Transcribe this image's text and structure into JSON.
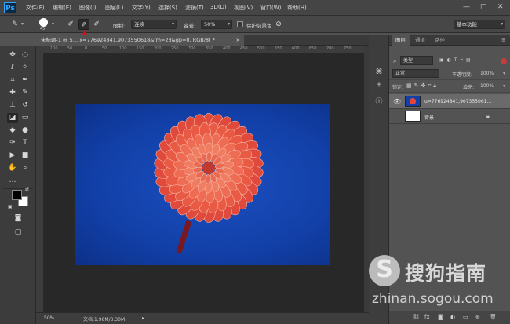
{
  "app": {
    "logo": "Ps"
  },
  "menu": [
    "文件(F)",
    "编辑(E)",
    "图像(I)",
    "图层(L)",
    "文字(Y)",
    "选择(S)",
    "滤镜(T)",
    "3D(D)",
    "视图(V)",
    "窗口(W)",
    "帮助(H)"
  ],
  "window_controls": {
    "minimize": "—",
    "maximize": "□",
    "close": "✕"
  },
  "options": {
    "brush_size": "45",
    "limit_label": "限制:",
    "limit_value": "连续",
    "tolerance_label": "容差:",
    "tolerance_value": "50%",
    "protect_fg_label": "保护前景色",
    "workspace": "基本功能"
  },
  "document": {
    "tab_title": "未标题-1 @ 5… x=776924841,9073550618&fm=23&gp=0, RGB/8) *",
    "tab_close": "×",
    "zoom": "50%",
    "doc_info": "文档:1.98M/3.30M"
  },
  "ruler_ticks": [
    "100",
    "50",
    "0",
    "50",
    "100",
    "150",
    "200",
    "250",
    "300",
    "350",
    "400",
    "450",
    "500",
    "550",
    "600",
    "650",
    "700",
    "750"
  ],
  "layers_panel": {
    "tabs": [
      "图层",
      "通道",
      "路径"
    ],
    "filter_label": "类型",
    "blend_mode": "正常",
    "opacity_label": "不透明度:",
    "opacity_value": "100%",
    "lock_label": "锁定:",
    "fill_label": "填充:",
    "fill_value": "100%",
    "layers": [
      {
        "name": "u=776924841,907355061...",
        "selected": true
      },
      {
        "name": "背景",
        "selected": false
      }
    ],
    "bottom_icons": [
      "fx"
    ]
  },
  "watermark": {
    "logo": "S",
    "title": "搜狗指南",
    "url": "zhinan.sogou.com"
  },
  "colors": {
    "accent": "#31a8ff",
    "arrow": "#d0101c",
    "canvas_bg": "#1240a8",
    "flower": "#e8483c"
  }
}
